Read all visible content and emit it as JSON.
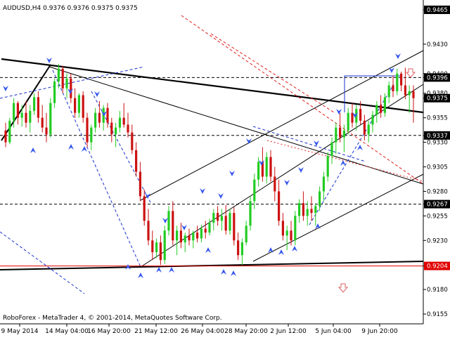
{
  "header": {
    "symbol_line": "AUDUSD,H4  0.9376 0.9376 0.9375 0.9375"
  },
  "footer": {
    "copyright": "RoboForex - MetaTrader 4, © 2001-2014, MetaQuotes Software Corp."
  },
  "colors": {
    "background": "#ffffff",
    "bull_candle": "#22cc22",
    "bear_candle": "#cc1111",
    "trendline": "#000000",
    "channel_dashed": "#1a33cc",
    "red_dashed": "#e02020",
    "support_red": "#e00000",
    "price_tag_bg": "#000000",
    "price_tag_highlight_bg": "#e00000",
    "price_tag_text": "#ffffff",
    "arrow_blue": "#3355ee",
    "arrow_red": "#e06060"
  },
  "chart_data": {
    "type": "candlestick",
    "title": "AUDUSD,H4",
    "ylim": [
      0.9145,
      0.9475
    ],
    "y_ticks": [
      "0.9465",
      "0.9430",
      "0.9400",
      "0.9396",
      "0.9380",
      "0.9375",
      "0.9355",
      "0.9337",
      "0.9330",
      "0.9305",
      "0.9280",
      "0.9267",
      "0.9255",
      "0.9230",
      "0.9204",
      "0.9180",
      "0.9155"
    ],
    "x_ticks": [
      "9 May 2014",
      "14 May 04:00",
      "16 May 20:00",
      "21 May 12:00",
      "26 May 04:00",
      "28 May 20:00",
      "2 Jun 12:00",
      "5 Jun 04:00",
      "9 Jun 20:00"
    ],
    "last_price": 0.9375,
    "levels": [
      {
        "value": 0.9396,
        "style": "dashed",
        "label": "0.9396"
      },
      {
        "value": 0.9337,
        "style": "dashed",
        "label": "0.9337"
      },
      {
        "value": 0.9267,
        "style": "dashed",
        "label": "0.9267"
      },
      {
        "value": 0.9204,
        "style": "solid-red",
        "label": "0.9204"
      }
    ],
    "candles": [
      [
        0.9342,
        0.935,
        0.9325,
        0.933
      ],
      [
        0.933,
        0.9355,
        0.9328,
        0.9352
      ],
      [
        0.9352,
        0.9375,
        0.9345,
        0.937
      ],
      [
        0.937,
        0.9372,
        0.9348,
        0.9355
      ],
      [
        0.9355,
        0.9368,
        0.9346,
        0.936
      ],
      [
        0.936,
        0.9372,
        0.9345,
        0.935
      ],
      [
        0.935,
        0.9368,
        0.934,
        0.9362
      ],
      [
        0.9362,
        0.938,
        0.9358,
        0.9376
      ],
      [
        0.9376,
        0.9382,
        0.935,
        0.9355
      ],
      [
        0.9355,
        0.9368,
        0.934,
        0.9345
      ],
      [
        0.9345,
        0.936,
        0.933,
        0.9338
      ],
      [
        0.9338,
        0.9375,
        0.9335,
        0.937
      ],
      [
        0.937,
        0.9395,
        0.9365,
        0.9392
      ],
      [
        0.9392,
        0.941,
        0.9385,
        0.9405
      ],
      [
        0.9405,
        0.9408,
        0.938,
        0.9385
      ],
      [
        0.9385,
        0.94,
        0.9375,
        0.9395
      ],
      [
        0.9395,
        0.94,
        0.937,
        0.9375
      ],
      [
        0.9375,
        0.9385,
        0.9355,
        0.936
      ],
      [
        0.936,
        0.938,
        0.9355,
        0.9378
      ],
      [
        0.9378,
        0.9382,
        0.935,
        0.9355
      ],
      [
        0.9355,
        0.936,
        0.9325,
        0.933
      ],
      [
        0.933,
        0.9348,
        0.9322,
        0.9345
      ],
      [
        0.9345,
        0.9365,
        0.934,
        0.936
      ],
      [
        0.936,
        0.9372,
        0.9345,
        0.935
      ],
      [
        0.935,
        0.9368,
        0.9342,
        0.9365
      ],
      [
        0.9365,
        0.937,
        0.9345,
        0.935
      ],
      [
        0.935,
        0.9355,
        0.933,
        0.9338
      ],
      [
        0.9338,
        0.935,
        0.9325,
        0.9345
      ],
      [
        0.9345,
        0.9362,
        0.934,
        0.9355
      ],
      [
        0.9355,
        0.937,
        0.9345,
        0.9348
      ],
      [
        0.9348,
        0.936,
        0.9335,
        0.934
      ],
      [
        0.934,
        0.9348,
        0.9318,
        0.9322
      ],
      [
        0.9322,
        0.933,
        0.9295,
        0.93
      ],
      [
        0.93,
        0.931,
        0.927,
        0.9275
      ],
      [
        0.9275,
        0.9282,
        0.9245,
        0.925
      ],
      [
        0.925,
        0.9262,
        0.9225,
        0.923
      ],
      [
        0.923,
        0.924,
        0.921,
        0.9218
      ],
      [
        0.9218,
        0.9232,
        0.9212,
        0.9228
      ],
      [
        0.9228,
        0.9235,
        0.9205,
        0.921
      ],
      [
        0.921,
        0.9245,
        0.9206,
        0.924
      ],
      [
        0.924,
        0.9265,
        0.9235,
        0.926
      ],
      [
        0.926,
        0.927,
        0.9225,
        0.923
      ],
      [
        0.923,
        0.9245,
        0.9215,
        0.924
      ],
      [
        0.924,
        0.9248,
        0.9222,
        0.9228
      ],
      [
        0.9228,
        0.9238,
        0.9218,
        0.9235
      ],
      [
        0.9235,
        0.9242,
        0.9225,
        0.923
      ],
      [
        0.923,
        0.924,
        0.9222,
        0.9238
      ],
      [
        0.9238,
        0.9245,
        0.9228,
        0.9232
      ],
      [
        0.9232,
        0.9246,
        0.9228,
        0.9242
      ],
      [
        0.9242,
        0.925,
        0.9232,
        0.9238
      ],
      [
        0.9238,
        0.9252,
        0.9235,
        0.9248
      ],
      [
        0.9248,
        0.9262,
        0.924,
        0.9258
      ],
      [
        0.9258,
        0.9265,
        0.9245,
        0.925
      ],
      [
        0.925,
        0.9262,
        0.924,
        0.9255
      ],
      [
        0.9255,
        0.9266,
        0.9236,
        0.924
      ],
      [
        0.924,
        0.9262,
        0.9236,
        0.9258
      ],
      [
        0.9258,
        0.9264,
        0.9225,
        0.923
      ],
      [
        0.923,
        0.9238,
        0.921,
        0.9215
      ],
      [
        0.9215,
        0.9232,
        0.9205,
        0.9228
      ],
      [
        0.9228,
        0.925,
        0.9225,
        0.9245
      ],
      [
        0.9245,
        0.9275,
        0.924,
        0.927
      ],
      [
        0.927,
        0.9298,
        0.9262,
        0.9292
      ],
      [
        0.9292,
        0.9315,
        0.9285,
        0.931
      ],
      [
        0.931,
        0.9325,
        0.929,
        0.9295
      ],
      [
        0.9295,
        0.932,
        0.9288,
        0.9315
      ],
      [
        0.9315,
        0.9322,
        0.929,
        0.9295
      ],
      [
        0.9295,
        0.9305,
        0.927,
        0.928
      ],
      [
        0.928,
        0.9292,
        0.9245,
        0.925
      ],
      [
        0.925,
        0.9258,
        0.923,
        0.9235
      ],
      [
        0.9235,
        0.9245,
        0.922,
        0.924
      ],
      [
        0.924,
        0.925,
        0.9225,
        0.923
      ],
      [
        0.923,
        0.926,
        0.9225,
        0.9255
      ],
      [
        0.9255,
        0.9272,
        0.9248,
        0.9268
      ],
      [
        0.9268,
        0.928,
        0.925,
        0.9255
      ],
      [
        0.9255,
        0.927,
        0.9245,
        0.9262
      ],
      [
        0.9262,
        0.9275,
        0.925,
        0.9258
      ],
      [
        0.9258,
        0.9268,
        0.9245,
        0.9265
      ],
      [
        0.9265,
        0.9285,
        0.926,
        0.928
      ],
      [
        0.928,
        0.93,
        0.927,
        0.9295
      ],
      [
        0.9295,
        0.932,
        0.929,
        0.9316
      ],
      [
        0.9316,
        0.9335,
        0.9308,
        0.933
      ],
      [
        0.933,
        0.935,
        0.9318,
        0.9345
      ],
      [
        0.9345,
        0.936,
        0.933,
        0.9335
      ],
      [
        0.9335,
        0.9348,
        0.932,
        0.9342
      ],
      [
        0.9342,
        0.9365,
        0.9338,
        0.936
      ],
      [
        0.936,
        0.937,
        0.9345,
        0.935
      ],
      [
        0.935,
        0.9368,
        0.9342,
        0.9364
      ],
      [
        0.9364,
        0.9372,
        0.9348,
        0.9352
      ],
      [
        0.9352,
        0.9358,
        0.9332,
        0.9338
      ],
      [
        0.9338,
        0.9352,
        0.933,
        0.9348
      ],
      [
        0.9348,
        0.9362,
        0.934,
        0.9358
      ],
      [
        0.9358,
        0.9372,
        0.935,
        0.9368
      ],
      [
        0.9368,
        0.9378,
        0.9355,
        0.936
      ],
      [
        0.936,
        0.938,
        0.9356,
        0.9376
      ],
      [
        0.9376,
        0.9392,
        0.937,
        0.9388
      ],
      [
        0.9388,
        0.9398,
        0.9376,
        0.9382
      ],
      [
        0.9382,
        0.9405,
        0.9378,
        0.94
      ],
      [
        0.94,
        0.9402,
        0.9382,
        0.9388
      ],
      [
        0.9388,
        0.9406,
        0.9374,
        0.9378
      ],
      [
        0.9378,
        0.9388,
        0.936,
        0.9382
      ],
      [
        0.9382,
        0.9388,
        0.935,
        0.9375
      ]
    ]
  }
}
